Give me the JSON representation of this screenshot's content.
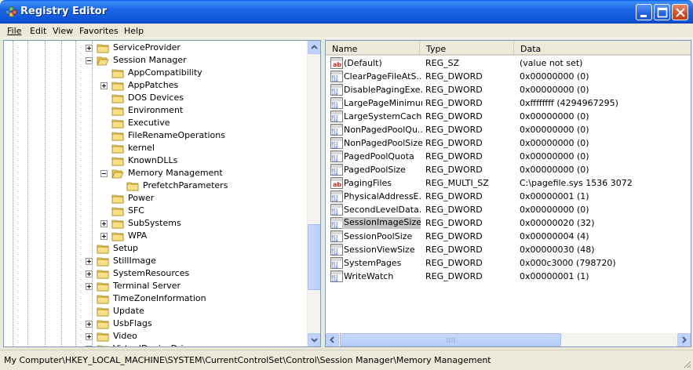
{
  "window": {
    "title": "Registry Editor"
  },
  "menu": {
    "file": "File",
    "edit": "Edit",
    "view": "View",
    "favorites": "Favorites",
    "help": "Help"
  },
  "tree": {
    "items": [
      {
        "label": "ServiceProvider",
        "expander": "plus"
      },
      {
        "label": "Session Manager",
        "expander": "minus"
      },
      {
        "label": "AppCompatibility",
        "expander": "none"
      },
      {
        "label": "AppPatches",
        "expander": "plus"
      },
      {
        "label": "DOS Devices",
        "expander": "none"
      },
      {
        "label": "Environment",
        "expander": "none"
      },
      {
        "label": "Executive",
        "expander": "none"
      },
      {
        "label": "FileRenameOperations",
        "expander": "none"
      },
      {
        "label": "kernel",
        "expander": "none"
      },
      {
        "label": "KnownDLLs",
        "expander": "none"
      },
      {
        "label": "Memory Management",
        "expander": "minus"
      },
      {
        "label": "PrefetchParameters",
        "expander": "none"
      },
      {
        "label": "Power",
        "expander": "none"
      },
      {
        "label": "SFC",
        "expander": "none"
      },
      {
        "label": "SubSystems",
        "expander": "plus"
      },
      {
        "label": "WPA",
        "expander": "plus"
      },
      {
        "label": "Setup",
        "expander": "none"
      },
      {
        "label": "StillImage",
        "expander": "plus"
      },
      {
        "label": "SystemResources",
        "expander": "plus"
      },
      {
        "label": "Terminal Server",
        "expander": "plus"
      },
      {
        "label": "TimeZoneInformation",
        "expander": "none"
      },
      {
        "label": "Update",
        "expander": "none"
      },
      {
        "label": "UsbFlags",
        "expander": "plus"
      },
      {
        "label": "Video",
        "expander": "plus"
      },
      {
        "label": "VirtualDeviceDrivers",
        "expander": "plus"
      }
    ]
  },
  "list": {
    "columns": {
      "name": "Name",
      "type": "Type",
      "data": "Data"
    },
    "rows": [
      {
        "name": "(Default)",
        "type": "REG_SZ",
        "data": "(value not set)",
        "icon": "string-value-icon"
      },
      {
        "name": "ClearPageFileAtS...",
        "type": "REG_DWORD",
        "data": "0x00000000 (0)",
        "icon": "binary-value-icon"
      },
      {
        "name": "DisablePagingExe...",
        "type": "REG_DWORD",
        "data": "0x00000000 (0)",
        "icon": "binary-value-icon"
      },
      {
        "name": "LargePageMinimum",
        "type": "REG_DWORD",
        "data": "0xffffffff (4294967295)",
        "icon": "binary-value-icon"
      },
      {
        "name": "LargeSystemCache",
        "type": "REG_DWORD",
        "data": "0x00000000 (0)",
        "icon": "binary-value-icon"
      },
      {
        "name": "NonPagedPoolQu...",
        "type": "REG_DWORD",
        "data": "0x00000000 (0)",
        "icon": "binary-value-icon"
      },
      {
        "name": "NonPagedPoolSize",
        "type": "REG_DWORD",
        "data": "0x00000000 (0)",
        "icon": "binary-value-icon"
      },
      {
        "name": "PagedPoolQuota",
        "type": "REG_DWORD",
        "data": "0x00000000 (0)",
        "icon": "binary-value-icon"
      },
      {
        "name": "PagedPoolSize",
        "type": "REG_DWORD",
        "data": "0x00000000 (0)",
        "icon": "binary-value-icon"
      },
      {
        "name": "PagingFiles",
        "type": "REG_MULTI_SZ",
        "data": "C:\\pagefile.sys 1536 3072",
        "icon": "string-value-icon"
      },
      {
        "name": "PhysicalAddressE...",
        "type": "REG_DWORD",
        "data": "0x00000001 (1)",
        "icon": "binary-value-icon"
      },
      {
        "name": "SecondLevelData...",
        "type": "REG_DWORD",
        "data": "0x00000000 (0)",
        "icon": "binary-value-icon"
      },
      {
        "name": "SessionImageSize",
        "type": "REG_DWORD",
        "data": "0x00000020 (32)",
        "icon": "binary-value-icon",
        "selected": true
      },
      {
        "name": "SessionPoolSize",
        "type": "REG_DWORD",
        "data": "0x00000004 (4)",
        "icon": "binary-value-icon"
      },
      {
        "name": "SessionViewSize",
        "type": "REG_DWORD",
        "data": "0x00000030 (48)",
        "icon": "binary-value-icon"
      },
      {
        "name": "SystemPages",
        "type": "REG_DWORD",
        "data": "0x000c3000 (798720)",
        "icon": "binary-value-icon"
      },
      {
        "name": "WriteWatch",
        "type": "REG_DWORD",
        "data": "0x00000001 (1)",
        "icon": "binary-value-icon"
      }
    ]
  },
  "status": {
    "path": "My Computer\\HKEY_LOCAL_MACHINE\\SYSTEM\\CurrentControlSet\\Control\\Session Manager\\Memory Management"
  },
  "colors": {
    "titlebar": "#0D55D8",
    "selection": "#C4C4C4",
    "folder": "#F7D774"
  }
}
